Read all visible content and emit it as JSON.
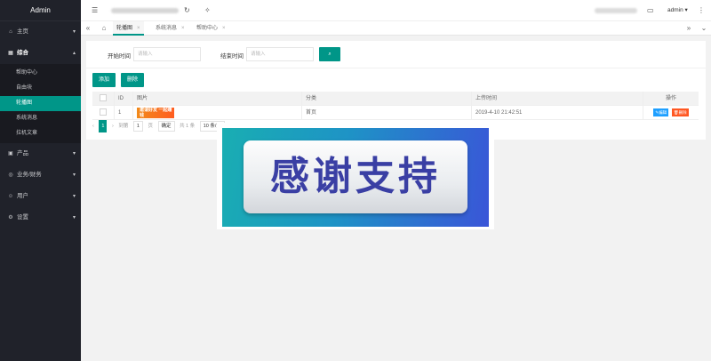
{
  "sidebar": {
    "title": "Admin",
    "items": [
      {
        "label": "主页",
        "icon": "home-icon"
      },
      {
        "label": "综合",
        "icon": "grid-icon"
      },
      {
        "label": "产品",
        "icon": "box-icon"
      },
      {
        "label": "业务/财务",
        "icon": "coin-icon"
      },
      {
        "label": "用户",
        "icon": "user-icon"
      },
      {
        "label": "设置",
        "icon": "gear-icon"
      }
    ],
    "sub_items": [
      "帮助中心",
      "自由块",
      "轮播图",
      "系统消息",
      "拉机文章"
    ]
  },
  "header": {
    "admin_name": "admin"
  },
  "tabs": [
    {
      "label": "轮播图"
    },
    {
      "label": "系统消息"
    },
    {
      "label": "帮助中心"
    }
  ],
  "filter": {
    "start_label": "开始时间",
    "start_placeholder": "请输入",
    "end_label": "结束时间",
    "end_placeholder": "请输入"
  },
  "toolbar": {
    "add_label": "添加",
    "delete_label": "删除"
  },
  "table": {
    "headers": [
      "ID",
      "图片",
      "分类",
      "上传时间",
      "操作"
    ],
    "rows": [
      {
        "id": "1",
        "image_text": "邀请好友 一起赚钱",
        "category": "首页",
        "upload_time": "2019-4-10 21:42:51",
        "edit_label": "编辑",
        "delete_label": "删除"
      }
    ]
  },
  "pager": {
    "current": "1",
    "goto_label": "到第",
    "page_input": "1",
    "page_unit": "页",
    "confirm": "确定",
    "total": "共 1 条",
    "per_page": "10 条/页"
  },
  "overlay": {
    "text": "感谢支持"
  },
  "colors": {
    "sidebar_bg": "#20222a",
    "accent": "#009688",
    "edit": "#1e9fff",
    "danger": "#ff5722"
  }
}
